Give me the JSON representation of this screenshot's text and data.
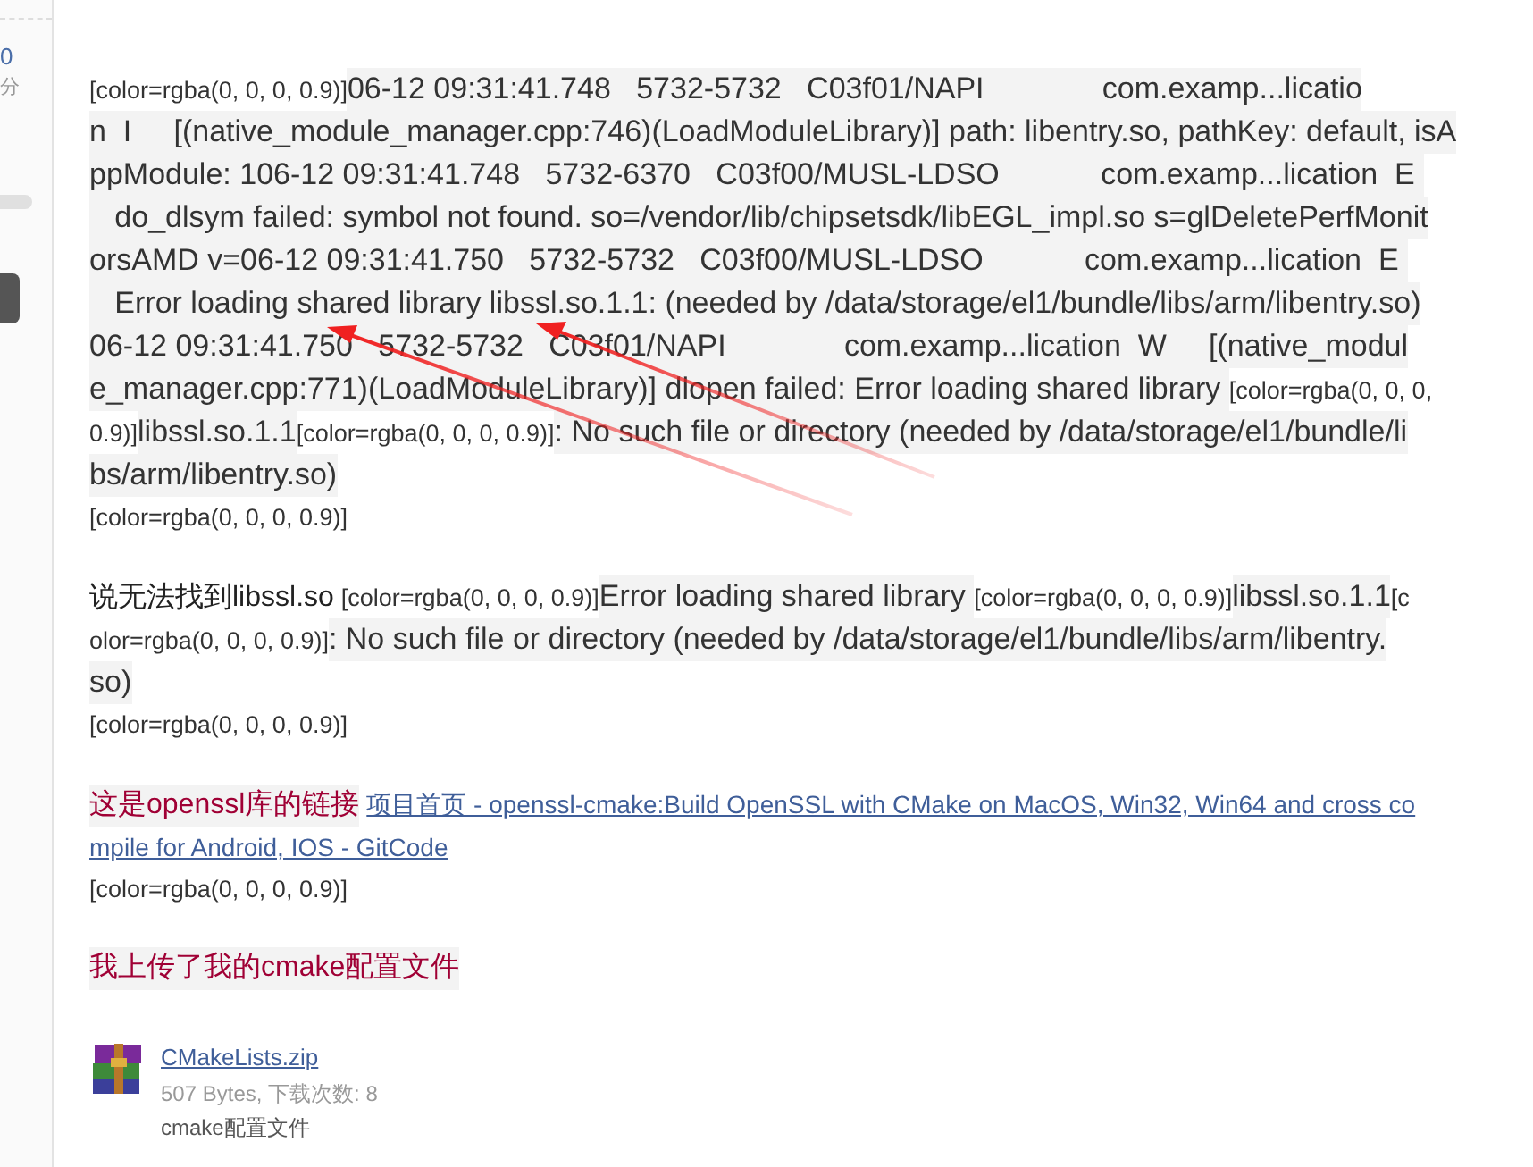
{
  "sidebar": {
    "texts": [
      "0",
      "分"
    ]
  },
  "blocks": [
    {
      "lines": [
        [
          {
            "kind": "tag",
            "text": "[color=rgba(0, 0, 0, 0.9)]"
          },
          {
            "kind": "code",
            "text": "06-12 09:31:41.748   5732-5732   C03f01/NAPI              com.examp...licatio"
          }
        ],
        [
          {
            "kind": "code",
            "text": "n  I     [(native_module_manager.cpp:746)(LoadModuleLibrary)] path: libentry.so, pathKey: default, isA"
          }
        ],
        [
          {
            "kind": "code",
            "text": "ppModule: 106-12 09:31:41.748   5732-6370   C03f00/MUSL-LDSO            com.examp...lication  E "
          }
        ],
        [
          {
            "kind": "code",
            "text": "   do_dlsym failed: symbol not found. so=/vendor/lib/chipsetsdk/libEGL_impl.so s=glDeletePerfMonit"
          }
        ],
        [
          {
            "kind": "code",
            "text": "orsAMD v=06-12 09:31:41.750   5732-5732   C03f00/MUSL-LDSO            com.examp...lication  E "
          }
        ],
        [
          {
            "kind": "code",
            "text": "   Error loading shared library libssl.so.1.1: (needed by /data/storage/el1/bundle/libs/arm/libentry.so)"
          }
        ],
        [
          {
            "kind": "code",
            "text": "06-12 09:31:41.750   5732-5732   C03f01/NAPI              com.examp...lication  W     [(native_modul"
          }
        ],
        [
          {
            "kind": "code",
            "text": "e_manager.cpp:771)(LoadModuleLibrary)] dlopen failed: Error loading shared library "
          },
          {
            "kind": "tag",
            "text": "[color=rgba(0, 0, 0,"
          }
        ],
        [
          {
            "kind": "tag",
            "text": "0.9)]"
          },
          {
            "kind": "code",
            "text": "libssl.so.1.1"
          },
          {
            "kind": "tag",
            "text": "[color=rgba(0, 0, 0, 0.9)]"
          },
          {
            "kind": "code",
            "text": ": No such file or directory (needed by /data/storage/el1/bundle/li"
          }
        ],
        [
          {
            "kind": "code",
            "text": "bs/arm/libentry.so)"
          }
        ],
        [
          {
            "kind": "tag",
            "text": "[color=rgba(0, 0, 0, 0.9)]"
          }
        ]
      ]
    },
    {
      "lines": [
        [
          {
            "kind": "plain",
            "text": "说无法找到libssl.so"
          },
          {
            "kind": "tag",
            "text": "[color=rgba(0, 0, 0, 0.9)]"
          },
          {
            "kind": "code",
            "text": "Error loading shared library "
          },
          {
            "kind": "tag",
            "text": "[color=rgba(0, 0, 0, 0.9)]"
          },
          {
            "kind": "code",
            "text": "libssl.so.1.1"
          },
          {
            "kind": "tag",
            "text": "[c"
          }
        ],
        [
          {
            "kind": "tag",
            "text": "olor=rgba(0, 0, 0, 0.9)]"
          },
          {
            "kind": "code",
            "text": ": No such file or directory (needed by /data/storage/el1/bundle/libs/arm/libentry."
          }
        ],
        [
          {
            "kind": "code",
            "text": "so)"
          }
        ],
        [
          {
            "kind": "tag",
            "text": "[color=rgba(0, 0, 0, 0.9)]"
          }
        ]
      ]
    },
    {
      "lines": [
        [
          {
            "kind": "red",
            "text": "这是openssl库的链接"
          },
          {
            "kind": "link",
            "text": "项目首页 - openssl-cmake:Build OpenSSL with CMake on MacOS, Win32, Win64 and cross co"
          }
        ],
        [
          {
            "kind": "link",
            "text": "mpile for Android, IOS - GitCode"
          }
        ],
        [
          {
            "kind": "tag",
            "text": "[color=rgba(0, 0, 0, 0.9)]"
          }
        ]
      ]
    },
    {
      "lines": [
        [
          {
            "kind": "red",
            "text": "我上传了我的cmake配置文件"
          }
        ]
      ]
    }
  ],
  "attachment": {
    "name": "CMakeLists.zip",
    "meta": "507 Bytes, 下载次数: 8",
    "description": "cmake配置文件"
  }
}
